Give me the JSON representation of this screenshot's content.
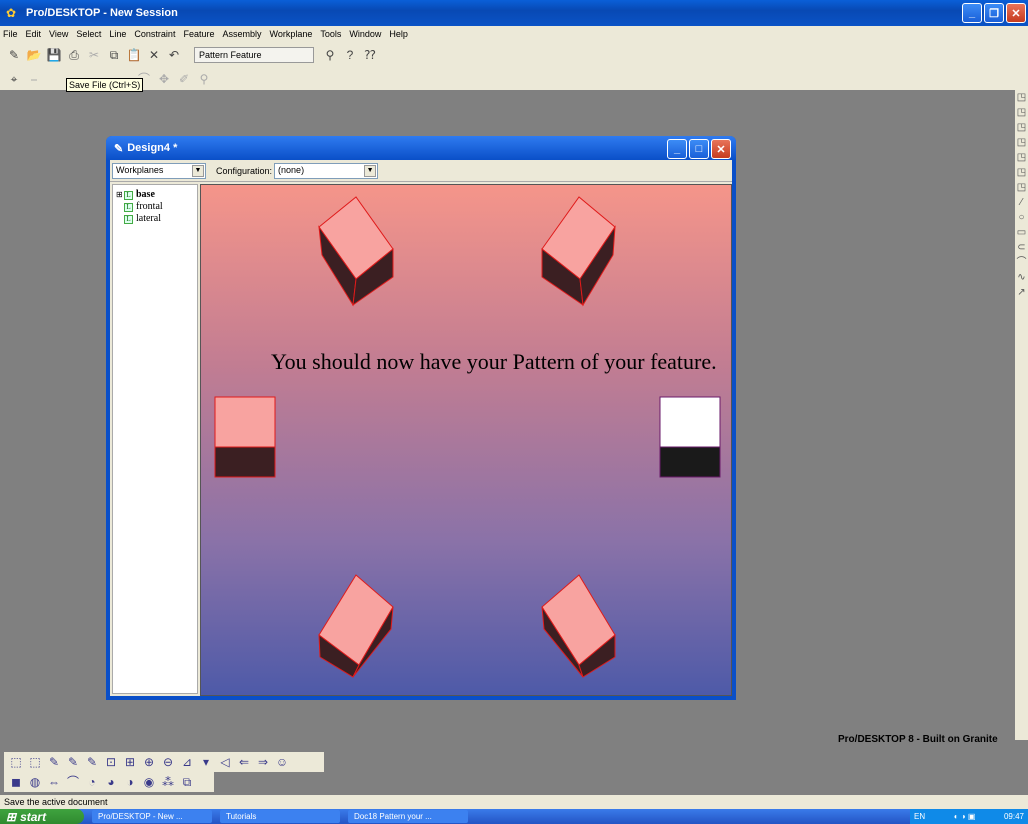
{
  "app": {
    "title": "Pro/DESKTOP - New Session"
  },
  "menu": [
    "File",
    "Edit",
    "View",
    "Select",
    "Line",
    "Constraint",
    "Feature",
    "Assembly",
    "Workplane",
    "Tools",
    "Window",
    "Help"
  ],
  "toolbar": {
    "pattern_field": "Pattern Feature",
    "tooltip": "Save File (Ctrl+S)"
  },
  "design_window": {
    "title": "Design4 *",
    "workplanes_label": "Workplanes",
    "configuration_label": "Configuration:",
    "configuration_value": "(none)",
    "tree": [
      {
        "label": "base",
        "bold": true
      },
      {
        "label": "frontal"
      },
      {
        "label": "lateral"
      }
    ],
    "instruction": "You should now have your Pattern of your feature."
  },
  "colors": {
    "face": "#f8a3a0",
    "dark": "#3b1f22",
    "edge": "#e01a1a",
    "selected_face": "#ffffff",
    "selected_dark": "#1a1a1a",
    "selected_edge": "#6a1a6a"
  },
  "brand": "Pro/DESKTOP 8 - Built on Granite",
  "status": "Save the active document",
  "taskbar": {
    "start": "start",
    "tasks": [
      "Pro/DESKTOP - New ...",
      "Tutorials",
      "Doc18 Pattern your ..."
    ],
    "lang": "EN",
    "clock": "09:47"
  }
}
